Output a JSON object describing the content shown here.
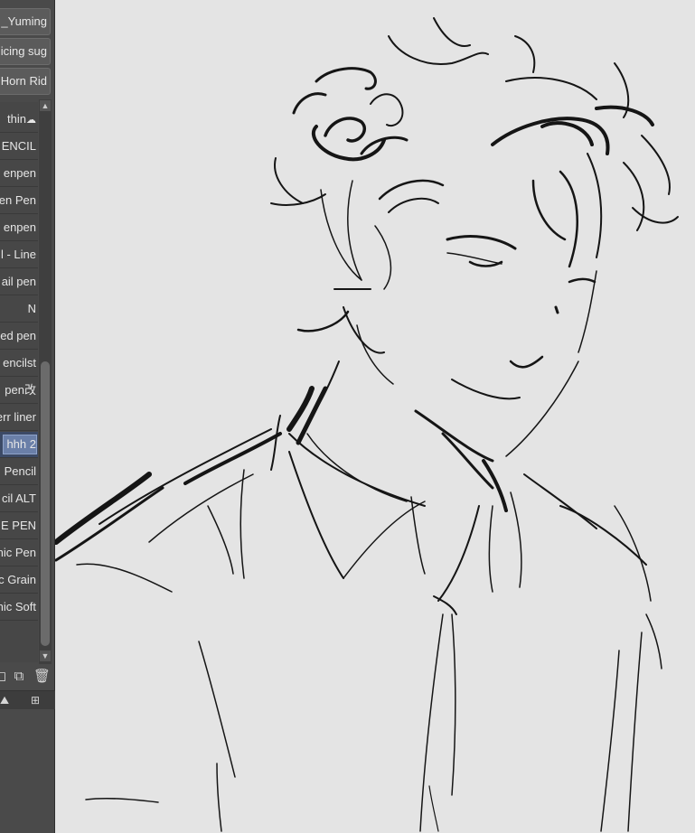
{
  "tabs": [
    "Yuming_",
    "icing sug",
    "Horn Rid"
  ],
  "brushes": [
    {
      "label": "thin"
    },
    {
      "label": "ENCIL"
    },
    {
      "label": "enpen"
    },
    {
      "label": "en Pen"
    },
    {
      "label": "enpen"
    },
    {
      "label": "l - Line"
    },
    {
      "label": "ail pen"
    },
    {
      "label": "N"
    },
    {
      "label": "ed pen"
    },
    {
      "label": "encilst"
    },
    {
      "label": "pen改"
    },
    {
      "label": "err liner"
    },
    {
      "label": "hhh 2"
    },
    {
      "label": "Pencil"
    },
    {
      "label": "cil ALT"
    },
    {
      "label": "E PEN"
    },
    {
      "label": "nic Pen"
    },
    {
      "label": "c Grain"
    },
    {
      "label": "nic Soft"
    }
  ],
  "selected_brush": "hhh 2",
  "colors": {
    "panel": "#4a4a4a",
    "canvas": "#e4e4e4",
    "selection": "#6a7fa8"
  },
  "icons": [
    "cloud-icon",
    "new-layer-icon",
    "duplicate-icon",
    "trash-icon",
    "mountain-icon",
    "nodes-icon"
  ]
}
